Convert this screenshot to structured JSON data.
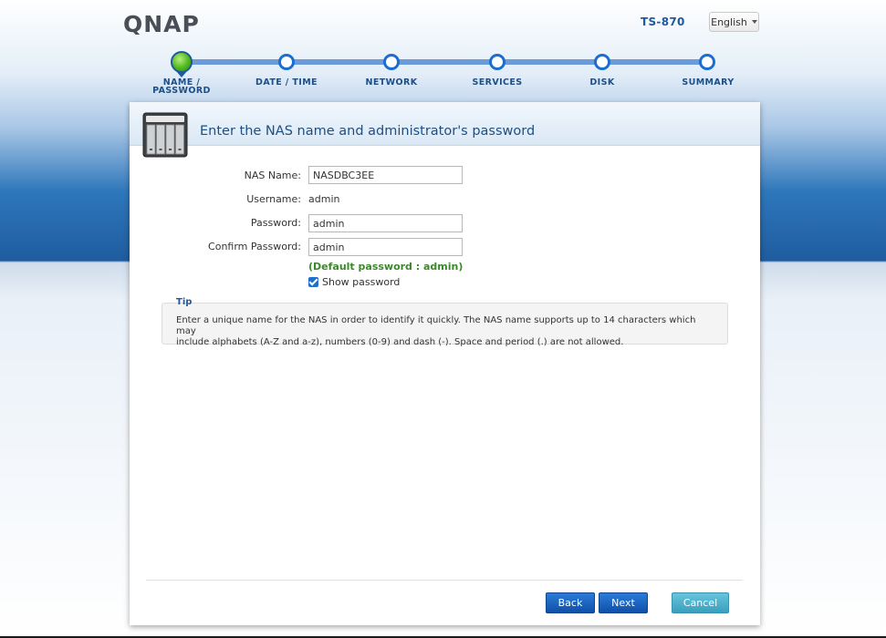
{
  "header": {
    "logo_text": "QNAP",
    "model": "TS-870",
    "language_label": "English"
  },
  "steps": [
    {
      "label_line1": "NAME /",
      "label_line2": "PASSWORD",
      "active": true
    },
    {
      "label_line1": "DATE / TIME",
      "label_line2": "",
      "active": false
    },
    {
      "label_line1": "NETWORK",
      "label_line2": "",
      "active": false
    },
    {
      "label_line1": "SERVICES",
      "label_line2": "",
      "active": false
    },
    {
      "label_line1": "DISK",
      "label_line2": "",
      "active": false
    },
    {
      "label_line1": "SUMMARY",
      "label_line2": "",
      "active": false
    }
  ],
  "panel": {
    "title": "Enter the NAS name and administrator's password"
  },
  "form": {
    "nas_name_label": "NAS Name:",
    "nas_name_value": "NASDBC3EE",
    "username_label": "Username:",
    "username_value": "admin",
    "password_label": "Password:",
    "password_value": "admin",
    "confirm_label": "Confirm Password:",
    "confirm_value": "admin",
    "default_hint": "(Default password : admin)",
    "show_password_label": "Show password",
    "show_password_checked": true
  },
  "tip": {
    "title": "Tip",
    "line1": "Enter a unique name for the NAS in order to identify it quickly. The NAS name supports up to 14 characters which may",
    "line2": "include alphabets (A-Z and a-z), numbers (0-9) and dash (-). Space and period (.) are not allowed."
  },
  "buttons": {
    "back": "Back",
    "next": "Next",
    "cancel": "Cancel"
  },
  "colors": {
    "brand_blue": "#1d5a9e",
    "step_active_green": "#4fb81f",
    "hint_green": "#3a8a2a"
  }
}
